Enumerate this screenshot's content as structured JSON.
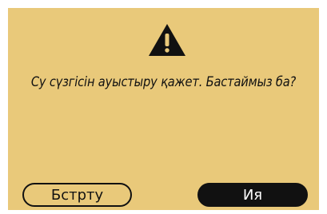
{
  "dialog": {
    "icon": "warning-icon",
    "message": "Су сүзгісін ауыстыру қажет. Бастаймыз ба?",
    "cancel_label": "Бстрту",
    "confirm_label": "Ия"
  },
  "colors": {
    "background": "#e9c97a",
    "text": "#111111",
    "confirm_button_bg": "#111111",
    "confirm_button_text": "#ffffff"
  }
}
